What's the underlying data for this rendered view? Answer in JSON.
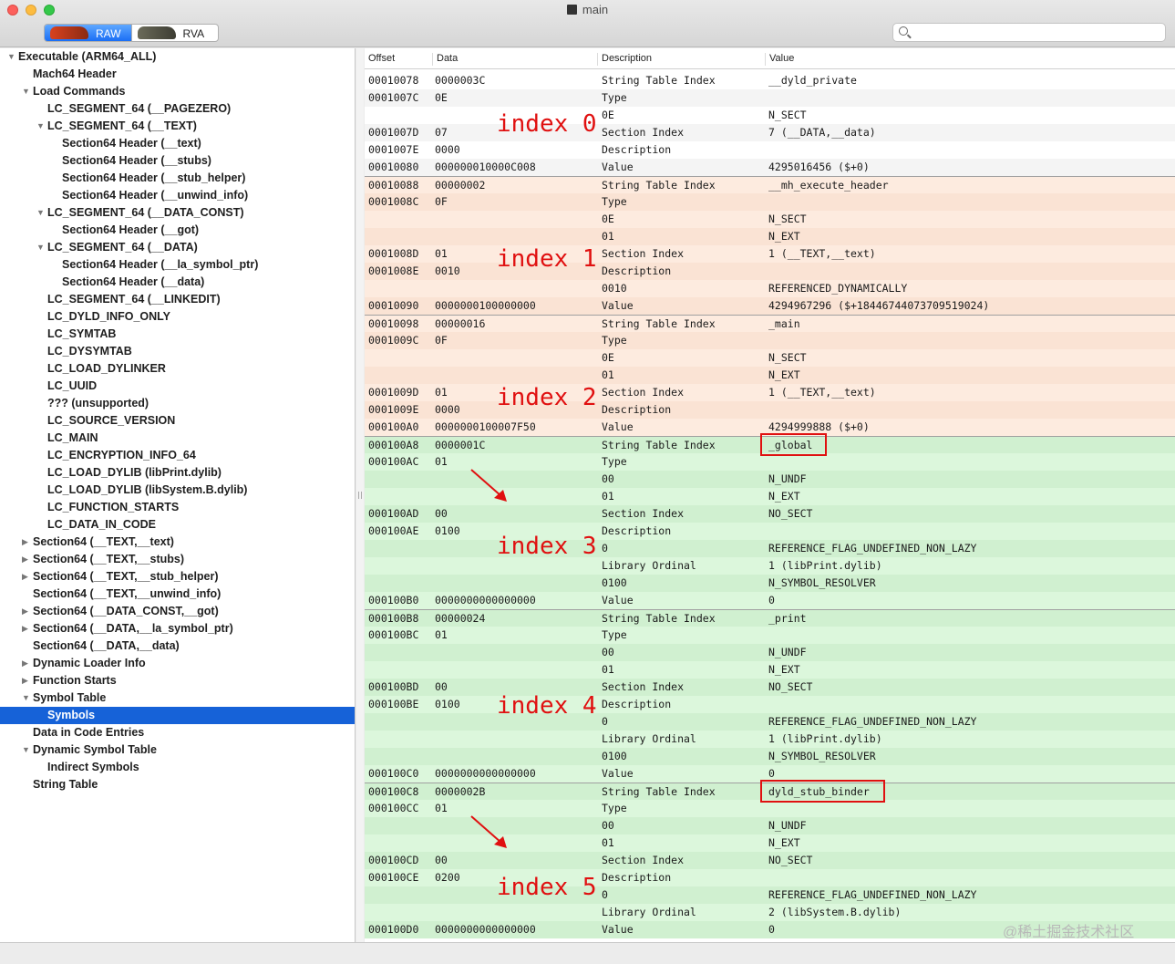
{
  "window": {
    "title": "main"
  },
  "toolbar": {
    "raw_label": "RAW",
    "rva_label": "RVA",
    "search_placeholder": ""
  },
  "sidebar": {
    "items": [
      {
        "label": "Executable  (ARM64_ALL)",
        "depth": 0,
        "disclosure": "open"
      },
      {
        "label": "Mach64 Header",
        "depth": 1,
        "disclosure": "none"
      },
      {
        "label": "Load Commands",
        "depth": 1,
        "disclosure": "open"
      },
      {
        "label": "LC_SEGMENT_64 (__PAGEZERO)",
        "depth": 2,
        "disclosure": "none"
      },
      {
        "label": "LC_SEGMENT_64 (__TEXT)",
        "depth": 2,
        "disclosure": "open"
      },
      {
        "label": "Section64 Header (__text)",
        "depth": 3,
        "disclosure": "none"
      },
      {
        "label": "Section64 Header (__stubs)",
        "depth": 3,
        "disclosure": "none"
      },
      {
        "label": "Section64 Header (__stub_helper)",
        "depth": 3,
        "disclosure": "none"
      },
      {
        "label": "Section64 Header (__unwind_info)",
        "depth": 3,
        "disclosure": "none"
      },
      {
        "label": "LC_SEGMENT_64 (__DATA_CONST)",
        "depth": 2,
        "disclosure": "open"
      },
      {
        "label": "Section64 Header (__got)",
        "depth": 3,
        "disclosure": "none"
      },
      {
        "label": "LC_SEGMENT_64 (__DATA)",
        "depth": 2,
        "disclosure": "open"
      },
      {
        "label": "Section64 Header (__la_symbol_ptr)",
        "depth": 3,
        "disclosure": "none"
      },
      {
        "label": "Section64 Header (__data)",
        "depth": 3,
        "disclosure": "none"
      },
      {
        "label": "LC_SEGMENT_64 (__LINKEDIT)",
        "depth": 2,
        "disclosure": "none"
      },
      {
        "label": "LC_DYLD_INFO_ONLY",
        "depth": 2,
        "disclosure": "none"
      },
      {
        "label": "LC_SYMTAB",
        "depth": 2,
        "disclosure": "none"
      },
      {
        "label": "LC_DYSYMTAB",
        "depth": 2,
        "disclosure": "none"
      },
      {
        "label": "LC_LOAD_DYLINKER",
        "depth": 2,
        "disclosure": "none"
      },
      {
        "label": "LC_UUID",
        "depth": 2,
        "disclosure": "none"
      },
      {
        "label": "??? (unsupported)",
        "depth": 2,
        "disclosure": "none"
      },
      {
        "label": "LC_SOURCE_VERSION",
        "depth": 2,
        "disclosure": "none"
      },
      {
        "label": "LC_MAIN",
        "depth": 2,
        "disclosure": "none"
      },
      {
        "label": "LC_ENCRYPTION_INFO_64",
        "depth": 2,
        "disclosure": "none"
      },
      {
        "label": "LC_LOAD_DYLIB (libPrint.dylib)",
        "depth": 2,
        "disclosure": "none"
      },
      {
        "label": "LC_LOAD_DYLIB (libSystem.B.dylib)",
        "depth": 2,
        "disclosure": "none"
      },
      {
        "label": "LC_FUNCTION_STARTS",
        "depth": 2,
        "disclosure": "none"
      },
      {
        "label": "LC_DATA_IN_CODE",
        "depth": 2,
        "disclosure": "none"
      },
      {
        "label": "Section64 (__TEXT,__text)",
        "depth": 1,
        "disclosure": "closed"
      },
      {
        "label": "Section64 (__TEXT,__stubs)",
        "depth": 1,
        "disclosure": "closed"
      },
      {
        "label": "Section64 (__TEXT,__stub_helper)",
        "depth": 1,
        "disclosure": "closed"
      },
      {
        "label": "Section64 (__TEXT,__unwind_info)",
        "depth": 1,
        "disclosure": "none"
      },
      {
        "label": "Section64 (__DATA_CONST,__got)",
        "depth": 1,
        "disclosure": "closed"
      },
      {
        "label": "Section64 (__DATA,__la_symbol_ptr)",
        "depth": 1,
        "disclosure": "closed"
      },
      {
        "label": "Section64 (__DATA,__data)",
        "depth": 1,
        "disclosure": "none"
      },
      {
        "label": "Dynamic Loader Info",
        "depth": 1,
        "disclosure": "closed"
      },
      {
        "label": "Function Starts",
        "depth": 1,
        "disclosure": "closed"
      },
      {
        "label": "Symbol Table",
        "depth": 1,
        "disclosure": "open"
      },
      {
        "label": "Symbols",
        "depth": 2,
        "disclosure": "none",
        "selected": true
      },
      {
        "label": "Data in Code Entries",
        "depth": 1,
        "disclosure": "none"
      },
      {
        "label": "Dynamic Symbol Table",
        "depth": 1,
        "disclosure": "open"
      },
      {
        "label": "Indirect Symbols",
        "depth": 2,
        "disclosure": "none"
      },
      {
        "label": "String Table",
        "depth": 1,
        "disclosure": "none"
      }
    ]
  },
  "table": {
    "columns": [
      "Offset",
      "Data",
      "Description",
      "Value"
    ],
    "rows": [
      {
        "off": "00010078",
        "data": "0000003C",
        "desc": "String Table Index",
        "val": "__dyld_private",
        "g": 0
      },
      {
        "off": "0001007C",
        "data": "0E",
        "desc": "Type",
        "val": "",
        "g": 0
      },
      {
        "off": "",
        "data": "",
        "desc": "0E",
        "val": "N_SECT",
        "g": 0
      },
      {
        "off": "0001007D",
        "data": "07",
        "desc": "Section Index",
        "val": "7 (__DATA,__data)",
        "g": 0
      },
      {
        "off": "0001007E",
        "data": "0000",
        "desc": "Description",
        "val": "",
        "g": 0
      },
      {
        "off": "00010080",
        "data": "000000010000C008",
        "desc": "Value",
        "val": "4295016456 ($+0)",
        "g": 0
      },
      {
        "off": "00010088",
        "data": "00000002",
        "desc": "String Table Index",
        "val": "__mh_execute_header",
        "g": 1
      },
      {
        "off": "0001008C",
        "data": "0F",
        "desc": "Type",
        "val": "",
        "g": 1
      },
      {
        "off": "",
        "data": "",
        "desc": "0E",
        "val": "N_SECT",
        "g": 1
      },
      {
        "off": "",
        "data": "",
        "desc": "01",
        "val": "N_EXT",
        "g": 1
      },
      {
        "off": "0001008D",
        "data": "01",
        "desc": "Section Index",
        "val": "1 (__TEXT,__text)",
        "g": 1
      },
      {
        "off": "0001008E",
        "data": "0010",
        "desc": "Description",
        "val": "",
        "g": 1
      },
      {
        "off": "",
        "data": "",
        "desc": "0010",
        "val": "REFERENCED_DYNAMICALLY",
        "g": 1
      },
      {
        "off": "00010090",
        "data": "0000000100000000",
        "desc": "Value",
        "val": "4294967296 ($+18446744073709519024)",
        "g": 1
      },
      {
        "off": "00010098",
        "data": "00000016",
        "desc": "String Table Index",
        "val": "_main",
        "g": 2
      },
      {
        "off": "0001009C",
        "data": "0F",
        "desc": "Type",
        "val": "",
        "g": 2
      },
      {
        "off": "",
        "data": "",
        "desc": "0E",
        "val": "N_SECT",
        "g": 2
      },
      {
        "off": "",
        "data": "",
        "desc": "01",
        "val": "N_EXT",
        "g": 2
      },
      {
        "off": "0001009D",
        "data": "01",
        "desc": "Section Index",
        "val": "1 (__TEXT,__text)",
        "g": 2
      },
      {
        "off": "0001009E",
        "data": "0000",
        "desc": "Description",
        "val": "",
        "g": 2
      },
      {
        "off": "000100A0",
        "data": "0000000100007F50",
        "desc": "Value",
        "val": "4294999888 ($+0)",
        "g": 2
      },
      {
        "off": "000100A8",
        "data": "0000001C",
        "desc": "String Table Index",
        "val": "_global",
        "g": 3
      },
      {
        "off": "000100AC",
        "data": "01",
        "desc": "Type",
        "val": "",
        "g": 3
      },
      {
        "off": "",
        "data": "",
        "desc": "00",
        "val": "N_UNDF",
        "g": 3
      },
      {
        "off": "",
        "data": "",
        "desc": "01",
        "val": "N_EXT",
        "g": 3
      },
      {
        "off": "000100AD",
        "data": "00",
        "desc": "Section Index",
        "val": "NO_SECT",
        "g": 3
      },
      {
        "off": "000100AE",
        "data": "0100",
        "desc": "Description",
        "val": "",
        "g": 3
      },
      {
        "off": "",
        "data": "",
        "desc": "0",
        "val": "REFERENCE_FLAG_UNDEFINED_NON_LAZY",
        "g": 3
      },
      {
        "off": "",
        "data": "",
        "desc": "Library Ordinal",
        "val": "1 (libPrint.dylib)",
        "g": 3
      },
      {
        "off": "",
        "data": "",
        "desc": "0100",
        "val": "N_SYMBOL_RESOLVER",
        "g": 3
      },
      {
        "off": "000100B0",
        "data": "0000000000000000",
        "desc": "Value",
        "val": "0",
        "g": 3
      },
      {
        "off": "000100B8",
        "data": "00000024",
        "desc": "String Table Index",
        "val": "_print",
        "g": 4
      },
      {
        "off": "000100BC",
        "data": "01",
        "desc": "Type",
        "val": "",
        "g": 4
      },
      {
        "off": "",
        "data": "",
        "desc": "00",
        "val": "N_UNDF",
        "g": 4
      },
      {
        "off": "",
        "data": "",
        "desc": "01",
        "val": "N_EXT",
        "g": 4
      },
      {
        "off": "000100BD",
        "data": "00",
        "desc": "Section Index",
        "val": "NO_SECT",
        "g": 4
      },
      {
        "off": "000100BE",
        "data": "0100",
        "desc": "Description",
        "val": "",
        "g": 4
      },
      {
        "off": "",
        "data": "",
        "desc": "0",
        "val": "REFERENCE_FLAG_UNDEFINED_NON_LAZY",
        "g": 4
      },
      {
        "off": "",
        "data": "",
        "desc": "Library Ordinal",
        "val": "1 (libPrint.dylib)",
        "g": 4
      },
      {
        "off": "",
        "data": "",
        "desc": "0100",
        "val": "N_SYMBOL_RESOLVER",
        "g": 4
      },
      {
        "off": "000100C0",
        "data": "0000000000000000",
        "desc": "Value",
        "val": "0",
        "g": 4
      },
      {
        "off": "000100C8",
        "data": "0000002B",
        "desc": "String Table Index",
        "val": "dyld_stub_binder",
        "g": 5
      },
      {
        "off": "000100CC",
        "data": "01",
        "desc": "Type",
        "val": "",
        "g": 5
      },
      {
        "off": "",
        "data": "",
        "desc": "00",
        "val": "N_UNDF",
        "g": 5
      },
      {
        "off": "",
        "data": "",
        "desc": "01",
        "val": "N_EXT",
        "g": 5
      },
      {
        "off": "000100CD",
        "data": "00",
        "desc": "Section Index",
        "val": "NO_SECT",
        "g": 5
      },
      {
        "off": "000100CE",
        "data": "0200",
        "desc": "Description",
        "val": "",
        "g": 5
      },
      {
        "off": "",
        "data": "",
        "desc": "0",
        "val": "REFERENCE_FLAG_UNDEFINED_NON_LAZY",
        "g": 5
      },
      {
        "off": "",
        "data": "",
        "desc": "Library Ordinal",
        "val": "2 (libSystem.B.dylib)",
        "g": 5
      },
      {
        "off": "000100D0",
        "data": "0000000000000000",
        "desc": "Value",
        "val": "0",
        "g": 5
      }
    ]
  },
  "annotations": {
    "index_labels": [
      "index 0",
      "index 1",
      "index 2",
      "index 3",
      "index 4",
      "index 5"
    ],
    "index_label_rows": [
      2.5,
      10.3,
      18.3,
      26.9,
      36.1,
      46.6
    ],
    "boxed_rows": [
      21,
      41
    ],
    "arrow_rows": [
      25,
      45
    ]
  },
  "colors": {
    "group_white": "#ffffff",
    "group_white_alt": "#f4f4f4",
    "group_orange": "#fdebdf",
    "group_orange_alt": "#fae3d4",
    "group_green": "#dcf7dc",
    "group_green_alt": "#d0f0d0",
    "annotation_red": "#e01010",
    "selection_blue": "#1662d8"
  },
  "watermark": "@稀土掘金技术社区"
}
